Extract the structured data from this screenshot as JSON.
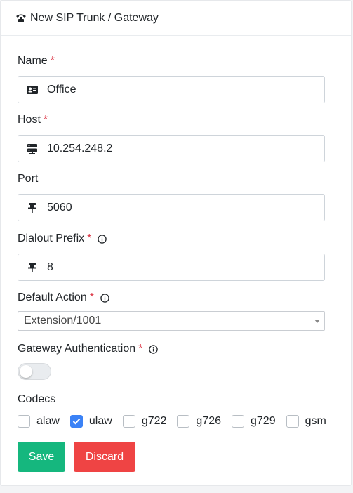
{
  "header": {
    "title": "New SIP Trunk / Gateway",
    "icon": "sip-trunk-icon"
  },
  "form": {
    "name": {
      "label": "Name",
      "required": "*",
      "value": "Office",
      "icon": "id-card-icon"
    },
    "host": {
      "label": "Host",
      "required": "*",
      "value": "10.254.248.2",
      "icon": "server-icon"
    },
    "port": {
      "label": "Port",
      "value": "5060",
      "icon": "pin-icon"
    },
    "dialout_prefix": {
      "label": "Dialout Prefix",
      "required": "*",
      "value": "8",
      "icon": "pin-icon",
      "info_icon": "info-icon"
    },
    "default_action": {
      "label": "Default Action",
      "required": "*",
      "selected": "Extension/1001",
      "info_icon": "info-icon"
    },
    "gateway_auth": {
      "label": "Gateway Authentication",
      "required": "*",
      "enabled": false,
      "info_icon": "info-icon"
    },
    "codecs": {
      "label": "Codecs",
      "items": [
        {
          "name": "alaw",
          "checked": false
        },
        {
          "name": "ulaw",
          "checked": true
        },
        {
          "name": "g722",
          "checked": false
        },
        {
          "name": "g726",
          "checked": false
        },
        {
          "name": "g729",
          "checked": false
        },
        {
          "name": "gsm",
          "checked": false
        }
      ]
    }
  },
  "buttons": {
    "save": "Save",
    "discard": "Discard"
  },
  "colors": {
    "save": "#15b77e",
    "discard": "#ef4444",
    "required": "#dc3545",
    "checkbox_checked": "#3b82f6"
  }
}
